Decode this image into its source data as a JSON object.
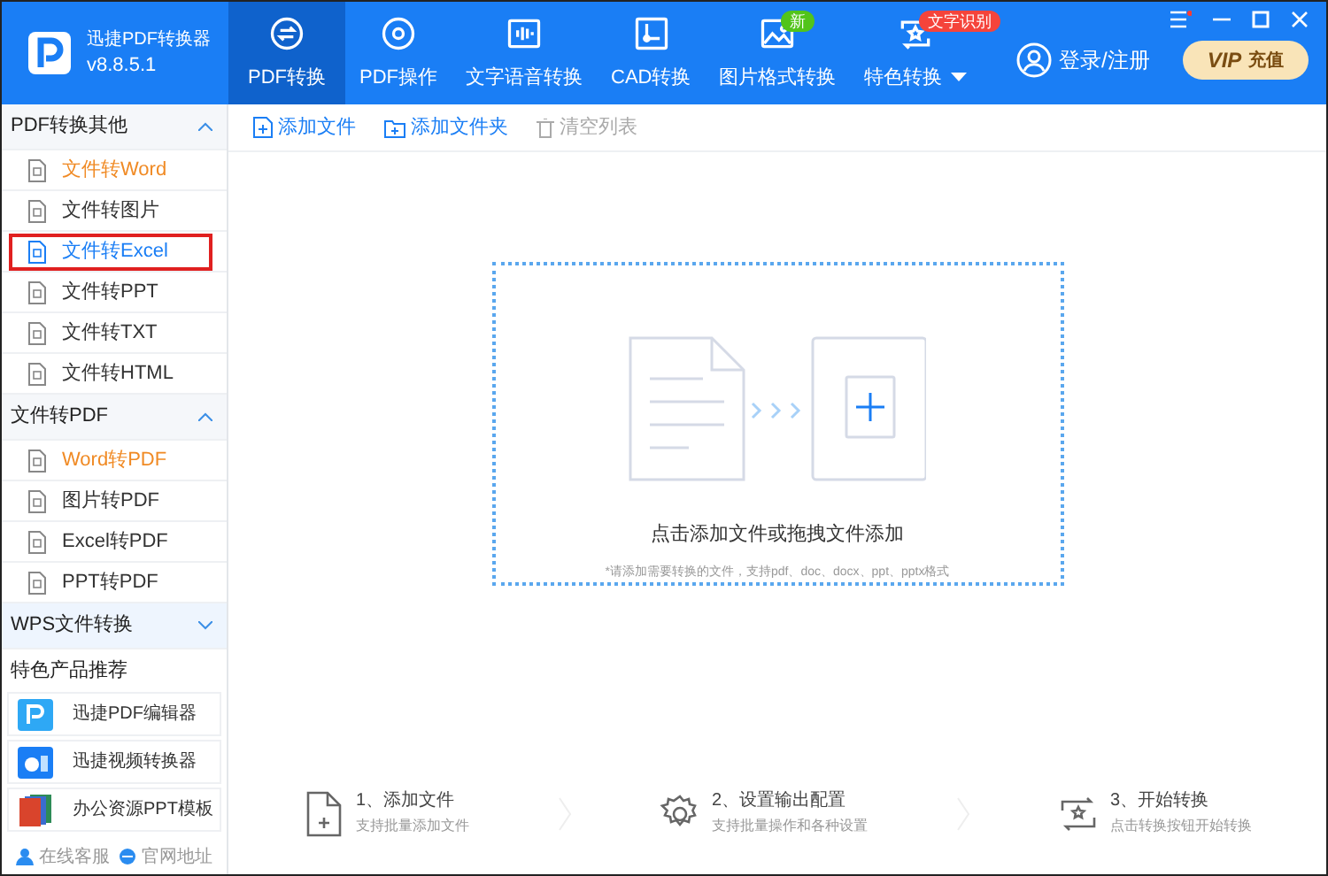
{
  "app": {
    "name": "迅捷PDF转换器",
    "version": "v8.8.5.1"
  },
  "nav": [
    {
      "label": "PDF转换",
      "selected": true
    },
    {
      "label": "PDF操作",
      "selected": false
    },
    {
      "label": "文字语音转换",
      "selected": false
    },
    {
      "label": "CAD转换",
      "selected": false
    },
    {
      "label": "图片格式转换",
      "selected": false,
      "badge": {
        "text": "新",
        "color": "#52c41a"
      }
    },
    {
      "label": "特色转换",
      "selected": false,
      "dropdown": true,
      "badge": {
        "text": "文字识别",
        "color": "#f5443b"
      }
    }
  ],
  "login": "登录/注册",
  "vip": {
    "label": "VIP",
    "sub": "充值"
  },
  "sidebar": {
    "groups": [
      {
        "title": "PDF转换其他",
        "expanded": true,
        "items": [
          {
            "label": "文件转Word",
            "hot": true,
            "selected": false
          },
          {
            "label": "文件转图片",
            "hot": false,
            "selected": false
          },
          {
            "label": "文件转Excel",
            "hot": false,
            "selected": true
          },
          {
            "label": "文件转PPT",
            "hot": false,
            "selected": false
          },
          {
            "label": "文件转TXT",
            "hot": false,
            "selected": false
          },
          {
            "label": "文件转HTML",
            "hot": false,
            "selected": false
          }
        ]
      },
      {
        "title": "文件转PDF",
        "expanded": true,
        "items": [
          {
            "label": "Word转PDF",
            "hot": true,
            "selected": false
          },
          {
            "label": "图片转PDF",
            "hot": false,
            "selected": false
          },
          {
            "label": "Excel转PDF",
            "hot": false,
            "selected": false
          },
          {
            "label": "PPT转PDF",
            "hot": false,
            "selected": false
          }
        ]
      },
      {
        "title": "WPS文件转换",
        "expanded": false
      }
    ],
    "products_title": "特色产品推荐",
    "products": [
      "迅捷PDF编辑器",
      "迅捷视频转换器",
      "办公资源PPT模板"
    ],
    "footer": [
      "在线客服",
      "官网地址"
    ]
  },
  "toolbar": [
    {
      "label": "添加文件",
      "disabled": false
    },
    {
      "label": "添加文件夹",
      "disabled": false
    },
    {
      "label": "清空列表",
      "disabled": true
    }
  ],
  "dropzone": {
    "title": "点击添加文件或拖拽文件添加",
    "hint": "*请添加需要转换的文件，支持pdf、doc、docx、ppt、pptx格式"
  },
  "steps": [
    {
      "title": "1、添加文件",
      "subtitle": "支持批量添加文件"
    },
    {
      "title": "2、设置输出配置",
      "subtitle": "支持批量操作和各种设置"
    },
    {
      "title": "3、开始转换",
      "subtitle": "点击转换按钮开始转换"
    }
  ]
}
